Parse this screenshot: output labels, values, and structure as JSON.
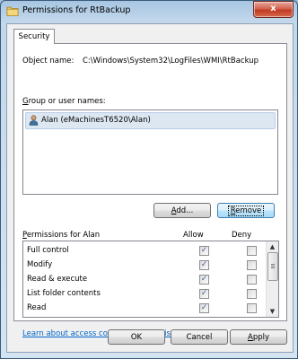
{
  "window": {
    "title": "Permissions for RtBackup",
    "close_glyph": "x"
  },
  "tabs": [
    {
      "label": "Security"
    }
  ],
  "object_name": {
    "label": "Object name:",
    "value": "C:\\Windows\\System32\\LogFiles\\WMI\\RtBackup"
  },
  "group": {
    "label_prefix": "G",
    "label_rest": "roup or user names:",
    "users": [
      {
        "name": "Alan (eMachinesT6520\\Alan)",
        "icon": "user-icon"
      }
    ]
  },
  "buttons": {
    "add": {
      "prefix": "A",
      "rest": "dd..."
    },
    "remove": {
      "prefix": "R",
      "rest": "emove"
    },
    "ok": "OK",
    "cancel": "Cancel",
    "apply": {
      "prefix": "A",
      "rest": "pply"
    }
  },
  "permissions": {
    "header_prefix": "P",
    "header_rest": "ermissions for Alan",
    "allow_label": "Allow",
    "deny_label": "Deny",
    "rows": [
      {
        "name": "Full control",
        "allow": true,
        "deny": false
      },
      {
        "name": "Modify",
        "allow": true,
        "deny": false
      },
      {
        "name": "Read & execute",
        "allow": true,
        "deny": false
      },
      {
        "name": "List folder contents",
        "allow": true,
        "deny": false
      },
      {
        "name": "Read",
        "allow": true,
        "deny": false
      }
    ],
    "check_glyph": "✓"
  },
  "link": "Learn about access control and permissions"
}
